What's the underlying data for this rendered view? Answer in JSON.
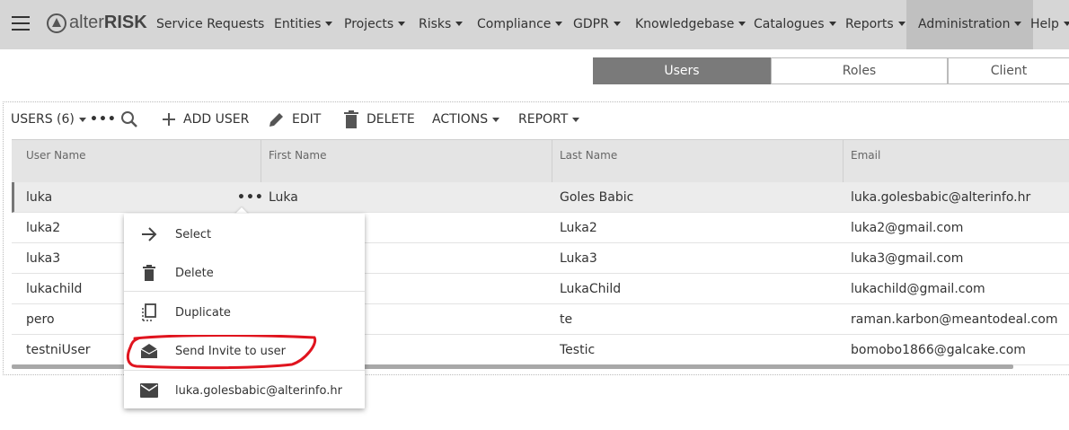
{
  "brand": {
    "name_light": "alter",
    "name_bold": "RISK"
  },
  "nav": {
    "items": [
      {
        "label": "Service Requests",
        "dropdown": false
      },
      {
        "label": "Entities",
        "dropdown": true
      },
      {
        "label": "Projects",
        "dropdown": true
      },
      {
        "label": "Risks",
        "dropdown": true
      },
      {
        "label": "Compliance",
        "dropdown": true
      },
      {
        "label": "GDPR",
        "dropdown": true
      },
      {
        "label": "Knowledgebase",
        "dropdown": true
      },
      {
        "label": "Catalogues",
        "dropdown": true
      },
      {
        "label": "Reports",
        "dropdown": true
      },
      {
        "label": "Administration",
        "dropdown": true,
        "active": true
      },
      {
        "label": "Help",
        "dropdown": true
      }
    ]
  },
  "tabs": [
    {
      "label": "Users",
      "active": true
    },
    {
      "label": "Roles",
      "active": false
    },
    {
      "label": "Client",
      "active": false
    }
  ],
  "toolbar": {
    "users_label": "USERS (6)",
    "add_user": "ADD USER",
    "edit": "EDIT",
    "delete": "DELETE",
    "actions": "ACTIONS",
    "report": "REPORT"
  },
  "grid": {
    "columns": [
      "User Name",
      "First Name",
      "Last Name",
      "Email"
    ],
    "rows": [
      {
        "username": "luka",
        "first": "Luka",
        "last": "Goles Babic",
        "email": "luka.golesbabic@alterinfo.hr",
        "selected": true
      },
      {
        "username": "luka2",
        "first": "",
        "last": "Luka2",
        "email": "luka2@gmail.com"
      },
      {
        "username": "luka3",
        "first": "",
        "last": "Luka3",
        "email": "luka3@gmail.com"
      },
      {
        "username": "lukachild",
        "first": "",
        "last": "LukaChild",
        "email": "lukachild@gmail.com"
      },
      {
        "username": "pero",
        "first": "",
        "last": "te",
        "email": "raman.karbon@meantodeal.com"
      },
      {
        "username": "testniUser",
        "first": "",
        "last": "Testic",
        "email": "bomobo1866@galcake.com"
      }
    ]
  },
  "context_menu": {
    "select": "Select",
    "delete": "Delete",
    "duplicate": "Duplicate",
    "send_invite": "Send Invite to user",
    "email": "luka.golesbabic@alterinfo.hr"
  },
  "colors": {
    "navbar": "#d6d6d6",
    "active_tab": "#7a7a7a",
    "annotation": "#e0141e"
  }
}
